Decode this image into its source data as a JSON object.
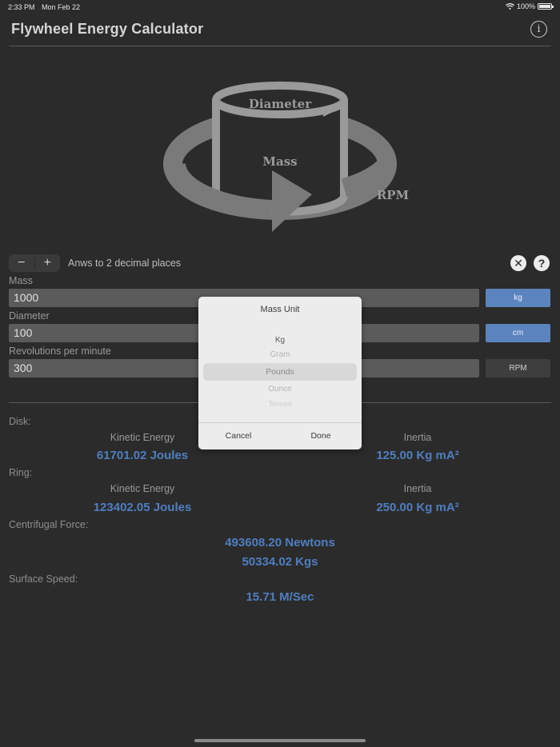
{
  "status_bar": {
    "time": "2:33 PM",
    "date": "Mon Feb 22",
    "battery": "100%"
  },
  "header": {
    "title": "Flywheel Energy Calculator",
    "info_glyph": "i"
  },
  "diagram": {
    "diameter_label": "Diameter",
    "mass_label": "Mass",
    "rpm_label": "RPM"
  },
  "controls": {
    "minus": "−",
    "plus": "+",
    "decimals_text": "Anws to 2 decimal places",
    "clear_glyph": "✕",
    "help_glyph": "?"
  },
  "inputs": {
    "mass": {
      "label": "Mass",
      "value": "1000",
      "unit": "kg"
    },
    "diameter": {
      "label": "Diameter",
      "value": "100",
      "unit": "cm"
    },
    "rpm": {
      "label": "Revolutions per minute",
      "value": "300",
      "unit": "RPM"
    }
  },
  "results": {
    "disk": {
      "label": "Disk:",
      "ke_label": "Kinetic Energy",
      "ke_value": "61701.02 Joules",
      "inertia_label": "Inertia",
      "inertia_value": "125.00 Kg mA²"
    },
    "ring": {
      "label": "Ring:",
      "ke_label": "Kinetic Energy",
      "ke_value": "123402.05 Joules",
      "inertia_label": "Inertia",
      "inertia_value": "250.00 Kg mA²"
    },
    "centrifugal": {
      "label": "Centrifugal Force:",
      "newtons": "493608.20 Newtons",
      "kgs": "50334.02 Kgs"
    },
    "surface": {
      "label": "Surface Speed:",
      "value": "15.71 M/Sec"
    }
  },
  "modal": {
    "title": "Mass Unit",
    "options": [
      "Kg",
      "Gram",
      "Pounds",
      "Ounce",
      "Tonnes"
    ],
    "selected": "Pounds",
    "cancel": "Cancel",
    "done": "Done"
  },
  "colors": {
    "background": "#2b2b2b",
    "accent_blue": "#4f7ec0",
    "unit_button_blue": "#5b84bf"
  }
}
